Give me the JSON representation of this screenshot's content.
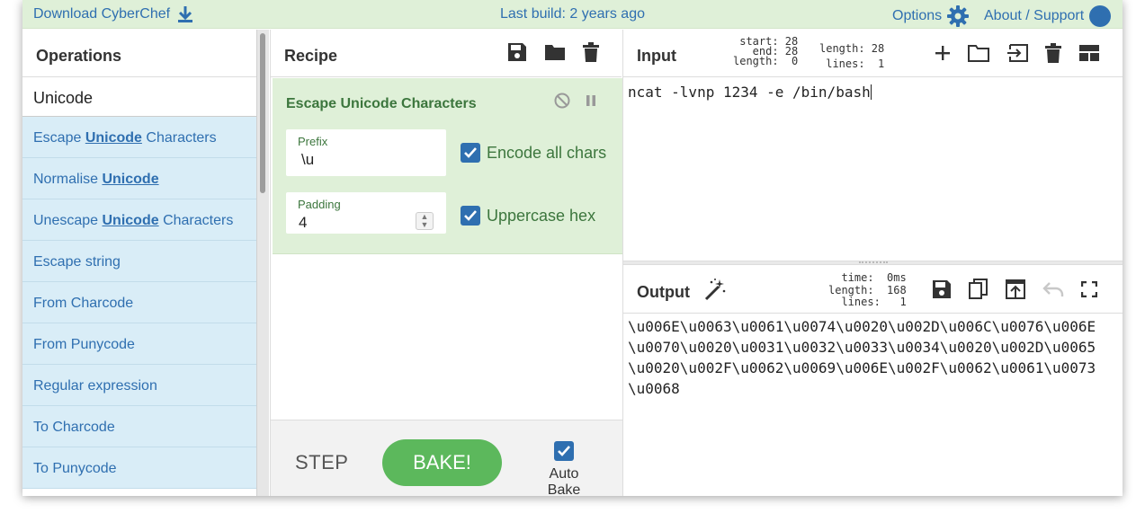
{
  "banner": {
    "download_label": "Download CyberChef",
    "last_build": "Last build: 2 years ago",
    "options_label": "Options",
    "about_label": "About / Support",
    "help_glyph": "?"
  },
  "operations": {
    "title": "Operations",
    "search_value": "Unicode",
    "items": [
      {
        "pre": "Escape ",
        "hl": "Unicode",
        "post": " Characters"
      },
      {
        "pre": "Normalise ",
        "hl": "Unicode",
        "post": ""
      },
      {
        "pre": "Unescape ",
        "hl": "Unicode",
        "post": " Characters"
      },
      {
        "pre": "Escape string",
        "hl": "",
        "post": ""
      },
      {
        "pre": "From Charcode",
        "hl": "",
        "post": ""
      },
      {
        "pre": "From Punycode",
        "hl": "",
        "post": ""
      },
      {
        "pre": "Regular expression",
        "hl": "",
        "post": ""
      },
      {
        "pre": "To Charcode",
        "hl": "",
        "post": ""
      },
      {
        "pre": "To Punycode",
        "hl": "",
        "post": ""
      }
    ]
  },
  "recipe": {
    "title": "Recipe",
    "operation": {
      "name": "Escape Unicode Characters",
      "prefix_label": "Prefix",
      "prefix_value": "\\u",
      "padding_label": "Padding",
      "padding_value": "4",
      "encode_all_label": "Encode all chars",
      "encode_all_checked": true,
      "uppercase_label": "Uppercase hex",
      "uppercase_checked": true
    },
    "step_label": "STEP",
    "bake_label": "BAKE!",
    "autobake_label": "Auto Bake",
    "autobake_checked": true
  },
  "input": {
    "title": "Input",
    "stats_left": "start: 28\n  end: 28\nlength:  0",
    "stats_right": "length: 28\n lines:  1",
    "text": "ncat -lvnp 1234 -e /bin/bash"
  },
  "output": {
    "title": "Output",
    "stats": "  time:  0ms\nlength:  168\n lines:   1",
    "text": "\\u006E\\u0063\\u0061\\u0074\\u0020\\u002D\\u006C\\u0076\\u006E\n\\u0070\\u0020\\u0031\\u0032\\u0033\\u0034\\u0020\\u002D\\u0065\n\\u0020\\u002F\\u0062\\u0069\\u006E\\u002F\\u0062\\u0061\\u0073\n\\u0068"
  },
  "colors": {
    "banner_bg": "#dff0d8",
    "link": "#2f6fb0",
    "op_bg": "#d9edf7",
    "bake_green": "#5cb85c",
    "recipe_text": "#3c763d"
  }
}
